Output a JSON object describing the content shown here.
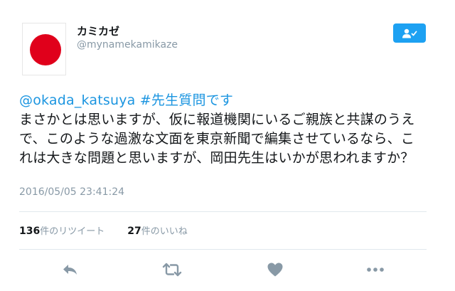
{
  "user": {
    "display_name": "カミカゼ",
    "screen_name": "@mynamekamikaze"
  },
  "follow_button": {
    "icon": "follow-user-icon",
    "color": "#1da1f2"
  },
  "tweet": {
    "mention": "@okada_katsuya",
    "hashtag": "#先生質問です",
    "line1": "まさかとは思いますが、仮に報道機関にいるご親族と共謀のうえ",
    "line2": "で、このような過激な文面を東京新聞で編集させているなら、こ",
    "line3": "れは大きな問題と思いますが、岡田先生はいかが思われますか？",
    "timestamp": "2016/05/05 23:41:24"
  },
  "stats": {
    "retweets_count": "136",
    "retweets_label": "件のリツイート",
    "likes_count": "27",
    "likes_label": "件のいいね"
  },
  "actions": [
    {
      "icon": "reply-icon"
    },
    {
      "icon": "retweet-icon"
    },
    {
      "icon": "heart-icon"
    },
    {
      "icon": "more-icon"
    }
  ],
  "colors": {
    "link": "#1b95e0",
    "muted": "#8899a6",
    "flag_red": "#e0001b"
  }
}
